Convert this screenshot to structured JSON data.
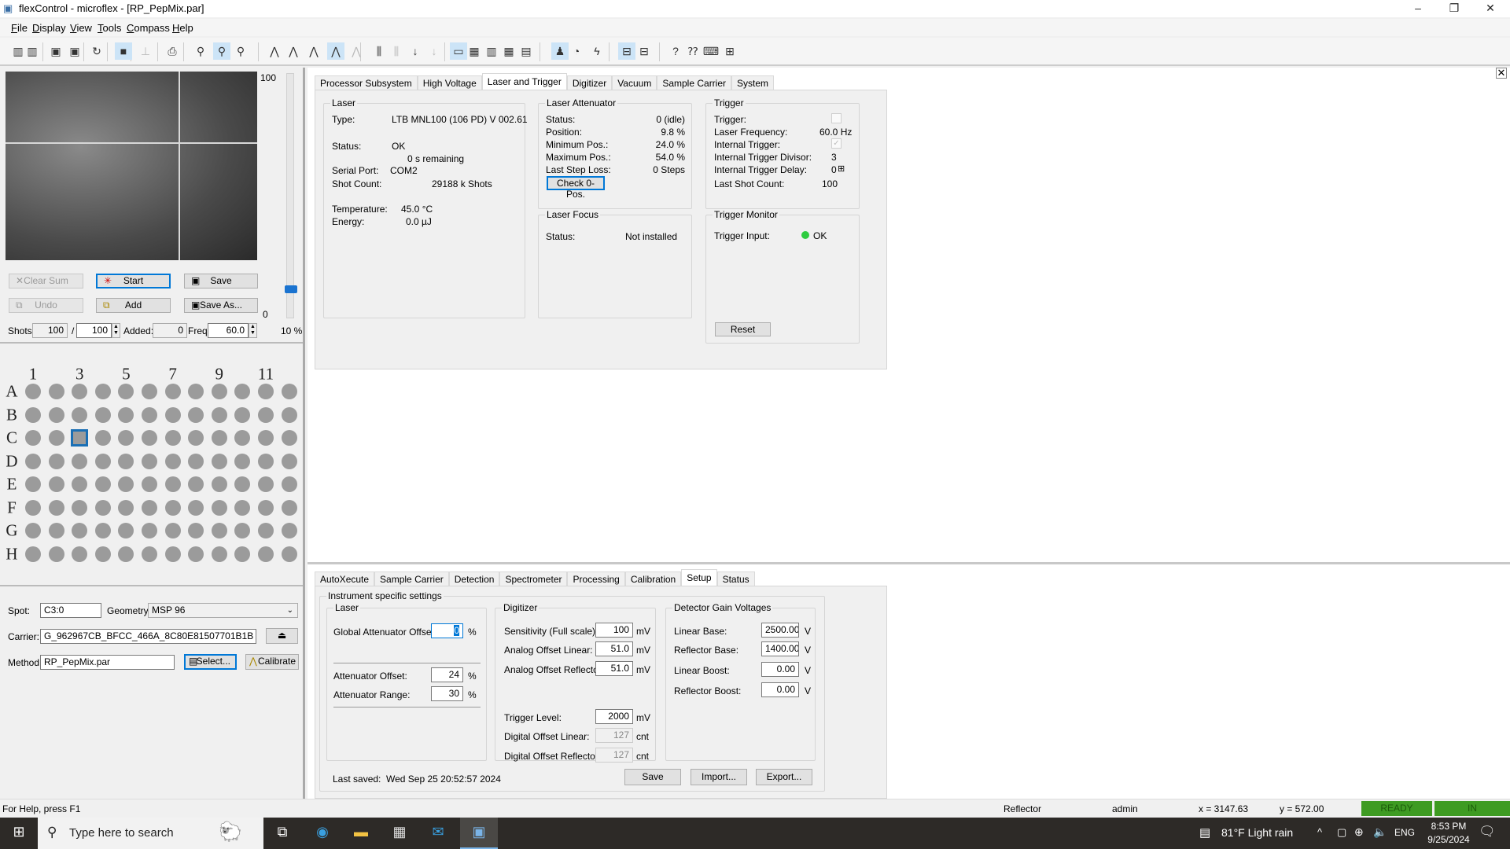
{
  "window": {
    "title": "flexControl - microflex - [RP_PepMix.par]",
    "minimize": "–",
    "maximize": "❐",
    "close": "✕"
  },
  "menu": [
    "File",
    "Display",
    "View",
    "Tools",
    "Compass",
    "Help"
  ],
  "toolbar_icons": [
    {
      "name": "open-method-icon",
      "glyph": "▥"
    },
    {
      "name": "open-method-2-icon",
      "glyph": "▥"
    },
    {
      "name": "save-icon",
      "glyph": "▣"
    },
    {
      "name": "save-as-icon",
      "glyph": "▣"
    },
    {
      "name": "refresh-icon",
      "glyph": "↻"
    },
    {
      "name": "video-icon",
      "glyph": "■",
      "state": "on"
    },
    {
      "name": "disabled-tool-icon",
      "glyph": "⊥",
      "state": "dis"
    },
    {
      "name": "print-icon",
      "glyph": "⎙"
    },
    {
      "name": "zoom-icon",
      "glyph": "⚲"
    },
    {
      "name": "zoom-x-icon",
      "glyph": "⚲",
      "state": "on"
    },
    {
      "name": "zoom-undo-icon",
      "glyph": "⚲"
    },
    {
      "name": "peak-tool-icon",
      "glyph": "⋀"
    },
    {
      "name": "peak-down-icon",
      "glyph": "⋀"
    },
    {
      "name": "peak-label-icon",
      "glyph": "⋀"
    },
    {
      "name": "spectrum-peak-icon",
      "glyph": "⋀",
      "state": "on"
    },
    {
      "name": "peak-info-icon",
      "glyph": "⋀",
      "state": "dis"
    },
    {
      "name": "spectrum-stack-icon",
      "glyph": "⫼"
    },
    {
      "name": "spectrum-stack-2-icon",
      "glyph": "⫼",
      "state": "dis"
    },
    {
      "name": "arrow-down-icon",
      "glyph": "↓"
    },
    {
      "name": "arrow-down-2-icon",
      "glyph": "↓",
      "state": "dis"
    },
    {
      "name": "layout-1-icon",
      "glyph": "▭",
      "state": "on"
    },
    {
      "name": "layout-2-icon",
      "glyph": "▦"
    },
    {
      "name": "layout-3-icon",
      "glyph": "▥"
    },
    {
      "name": "layout-4-icon",
      "glyph": "▦"
    },
    {
      "name": "layout-5-icon",
      "glyph": "▤"
    },
    {
      "name": "person-icon",
      "glyph": "♟",
      "state": "on"
    },
    {
      "name": "timer-icon",
      "glyph": "◔"
    },
    {
      "name": "laser-icon",
      "glyph": "ϟ"
    },
    {
      "name": "panel-left-icon",
      "glyph": "⊟",
      "state": "on"
    },
    {
      "name": "panel-right-icon",
      "glyph": "⊟"
    },
    {
      "name": "help-icon",
      "glyph": "?"
    },
    {
      "name": "context-help-icon",
      "glyph": "⁇"
    },
    {
      "name": "computer-icon",
      "glyph": "⌨"
    },
    {
      "name": "plugin-icon",
      "glyph": "⊞"
    }
  ],
  "acquisition": {
    "slider_max": "100",
    "slider_min": "0",
    "slider_percent": "10 %",
    "slider_value": 10,
    "clear_sum": "Clear Sum",
    "start": "Start",
    "save": "Save",
    "undo": "Undo",
    "add": "Add",
    "save_as": "Save As...",
    "shots_label": "Shots:",
    "shots": "100",
    "slash": "/",
    "shots_total": "100",
    "added_label": "Added:",
    "added": "0",
    "freq_label": "Freq:",
    "freq": "60.0"
  },
  "plate": {
    "col_labels": [
      "1",
      "3",
      "5",
      "7",
      "9",
      "11"
    ],
    "col_label_index": [
      0,
      2,
      4,
      6,
      8,
      10
    ],
    "rows": [
      "A",
      "B",
      "C",
      "D",
      "E",
      "F",
      "G",
      "H"
    ],
    "columns": 12,
    "selected": "C3"
  },
  "target": {
    "spot_label": "Spot:",
    "spot": "C3:0",
    "geometry_label": "Geometry:",
    "geometry": "MSP 96",
    "carrier_label": "Carrier:",
    "carrier": "G_962967CB_BFCC_466A_8C80E81507701B1B",
    "eject": "⏏",
    "method_label": "Method:",
    "method": "RP_PepMix.par",
    "select": "Select...",
    "calibrate": "Calibrate"
  },
  "top_tabs": [
    {
      "label": "Processor Subsystem"
    },
    {
      "label": "High Voltage"
    },
    {
      "label": "Laser and Trigger",
      "active": true
    },
    {
      "label": "Digitizer"
    },
    {
      "label": "Vacuum"
    },
    {
      "label": "Sample Carrier"
    },
    {
      "label": "System"
    }
  ],
  "laser": {
    "title": "Laser",
    "type_label": "Type:",
    "type": "LTB MNL100 (106 PD) V 002.61",
    "status_label": "Status:",
    "status": "OK",
    "remaining": "0 s remaining",
    "serial_label": "Serial Port:",
    "serial": "COM2",
    "shot_label": "Shot Count:",
    "shot": "29188 k Shots",
    "temp_label": "Temperature:",
    "temp": "45.0 °C",
    "energy_label": "Energy:",
    "energy": "0.0 µJ"
  },
  "attenuator": {
    "title": "Laser Attenuator",
    "rows": [
      {
        "label": "Status:",
        "value": "0 (idle)"
      },
      {
        "label": "Position:",
        "value": "9.8 %"
      },
      {
        "label": "Minimum Pos.:",
        "value": "24.0 %"
      },
      {
        "label": "Maximum Pos.:",
        "value": "54.0 %"
      },
      {
        "label": "Last Step Loss:",
        "value": "0 Steps"
      }
    ],
    "check_button": "Check 0-Pos."
  },
  "focus": {
    "title": "Laser Focus",
    "status_label": "Status:",
    "status": "Not installed"
  },
  "trigger": {
    "title": "Trigger",
    "trigger_label": "Trigger:",
    "trigger_checked": false,
    "freq_label": "Laser Frequency:",
    "freq": "60.0 Hz",
    "internal_label": "Internal Trigger:",
    "internal_checked": true,
    "divisor_label": "Internal Trigger Divisor:",
    "divisor": "3",
    "delay_label": "Internal Trigger Delay:",
    "delay": "0",
    "last_label": "Last Shot Count:",
    "last": "100"
  },
  "monitor": {
    "title": "Trigger Monitor",
    "input_label": "Trigger Input:",
    "input": "OK",
    "status_color": "#2ecc40",
    "reset": "Reset"
  },
  "bottom_tabs": [
    {
      "label": "AutoXecute"
    },
    {
      "label": "Sample Carrier"
    },
    {
      "label": "Detection"
    },
    {
      "label": "Spectrometer"
    },
    {
      "label": "Processing"
    },
    {
      "label": "Calibration"
    },
    {
      "label": "Setup",
      "active": true
    },
    {
      "label": "Status"
    }
  ],
  "setup": {
    "title": "Instrument specific settings",
    "laser": {
      "title": "Laser",
      "global_label": "Global Attenuator Offset:",
      "global": "0",
      "pct": "%",
      "offset_label": "Attenuator Offset:",
      "offset": "24",
      "range_label": "Attenuator Range:",
      "range": "30"
    },
    "digitizer": {
      "title": "Digitizer",
      "rows": [
        {
          "label": "Sensitivity (Full scale):",
          "value": "100",
          "unit": "mV"
        },
        {
          "label": "Analog Offset Linear:",
          "value": "51.0",
          "unit": "mV"
        },
        {
          "label": "Analog Offset Reflector:",
          "value": "51.0",
          "unit": "mV"
        },
        {
          "label": "Trigger Level:",
          "value": "2000",
          "unit": "mV"
        },
        {
          "label": "Digital Offset Linear:",
          "value": "127",
          "unit": "cnt",
          "disabled": true
        },
        {
          "label": "Digital Offset Reflector:",
          "value": "127",
          "unit": "cnt",
          "disabled": true
        }
      ]
    },
    "detector": {
      "title": "Detector Gain Voltages",
      "rows": [
        {
          "label": "Linear Base:",
          "value": "2500.00",
          "unit": "V"
        },
        {
          "label": "Reflector Base:",
          "value": "1400.00",
          "unit": "V"
        },
        {
          "label": "Linear Boost:",
          "value": "0.00",
          "unit": "V"
        },
        {
          "label": "Reflector Boost:",
          "value": "0.00",
          "unit": "V"
        }
      ]
    },
    "last_saved_label": "Last saved:",
    "last_saved": "Wed Sep 25 20:52:57 2024",
    "save": "Save",
    "import": "Import...",
    "export": "Export..."
  },
  "statusbar": {
    "help": "For Help, press F1",
    "mode": "Reflector",
    "user": "admin",
    "x": "x = 3147.63",
    "y": "y = 572.00",
    "ready": "READY",
    "in": "IN",
    "ok_color": "#3e9b22"
  },
  "taskbar": {
    "search_placeholder": "Type here to search",
    "weather": "81°F  Light rain",
    "lang": "ENG",
    "time": "8:53 PM",
    "date": "9/25/2024"
  }
}
